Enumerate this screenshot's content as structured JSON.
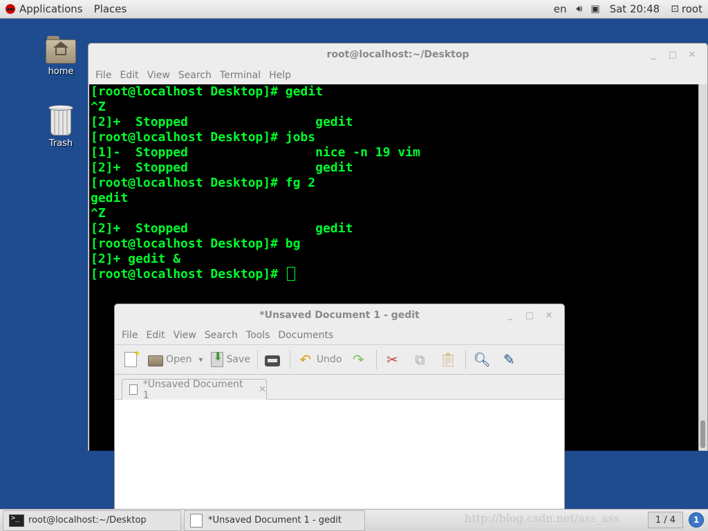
{
  "top_panel": {
    "applications": "Applications",
    "places": "Places",
    "keyboard_layout": "en",
    "clock": "Sat 20:48",
    "user": "root"
  },
  "desktop": {
    "icons": [
      {
        "label": "home",
        "icon": "home-folder-icon"
      },
      {
        "label": "Trash",
        "icon": "trash-icon"
      }
    ]
  },
  "terminal": {
    "title": "root@localhost:~/Desktop",
    "menu": [
      "File",
      "Edit",
      "View",
      "Search",
      "Terminal",
      "Help"
    ],
    "lines": [
      "[root@localhost Desktop]# gedit",
      "^Z",
      "[2]+  Stopped                 gedit",
      "[root@localhost Desktop]# jobs",
      "[1]-  Stopped                 nice -n 19 vim",
      "[2]+  Stopped                 gedit",
      "[root@localhost Desktop]# fg 2",
      "gedit",
      "^Z",
      "[2]+  Stopped                 gedit",
      "[root@localhost Desktop]# bg",
      "[2]+ gedit &",
      "[root@localhost Desktop]# "
    ]
  },
  "gedit": {
    "title": "*Unsaved Document 1 - gedit",
    "menu": [
      "File",
      "Edit",
      "View",
      "Search",
      "Tools",
      "Documents"
    ],
    "toolbar": {
      "open": "Open",
      "save": "Save",
      "undo": "Undo"
    },
    "tab_label": "*Unsaved Document 1"
  },
  "taskbar": {
    "items": [
      {
        "label": "root@localhost:~/Desktop",
        "icon": "terminal-icon"
      },
      {
        "label": "*Unsaved Document 1 - gedit",
        "icon": "gedit-icon"
      }
    ],
    "watermark": "http://blog.csdn.net/ass_ass",
    "workspace": "1 / 4",
    "notification_count": "1"
  },
  "window_controls": {
    "minimize": "_",
    "maximize": "□",
    "close": "✕"
  }
}
